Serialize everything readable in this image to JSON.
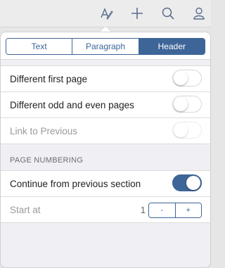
{
  "toolbar": {
    "icons": [
      "format-text-icon",
      "add-icon",
      "search-icon",
      "account-icon"
    ]
  },
  "segments": [
    {
      "label": "Text",
      "active": false
    },
    {
      "label": "Paragraph",
      "active": false
    },
    {
      "label": "Header",
      "active": true
    }
  ],
  "options": [
    {
      "label": "Different first page",
      "on": false,
      "disabled": false
    },
    {
      "label": "Different odd and even pages",
      "on": false,
      "disabled": false
    },
    {
      "label": "Link to Previous",
      "on": false,
      "disabled": true
    }
  ],
  "page_numbering": {
    "header": "PAGE NUMBERING",
    "continue_label": "Continue from previous section",
    "continue_on": true,
    "start_label": "Start at",
    "start_value": "1",
    "decrement": "-",
    "increment": "+"
  },
  "colors": {
    "accent": "#3d6598",
    "background": "#efeff4"
  }
}
